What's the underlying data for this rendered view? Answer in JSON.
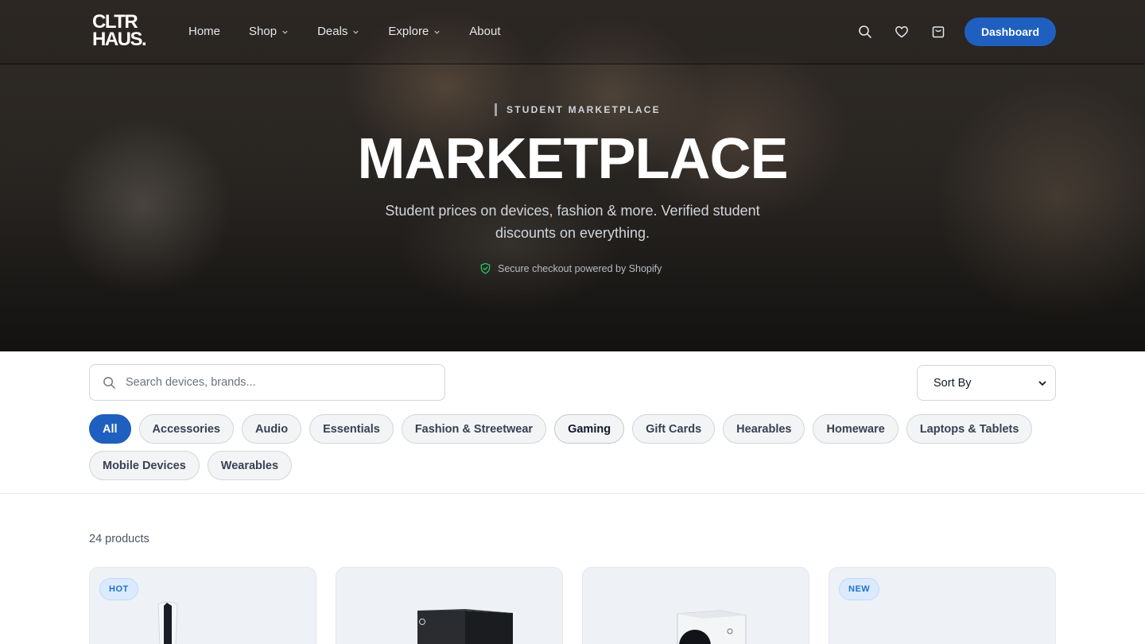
{
  "brand": {
    "logo_line1": "CLTR",
    "logo_line2": "HAUS."
  },
  "nav": {
    "links": [
      {
        "label": "Home",
        "has_dropdown": false
      },
      {
        "label": "Shop",
        "has_dropdown": true
      },
      {
        "label": "Deals",
        "has_dropdown": true
      },
      {
        "label": "Explore",
        "has_dropdown": true
      },
      {
        "label": "About",
        "has_dropdown": false
      }
    ],
    "icons": [
      "search-icon",
      "heart-icon",
      "shopping-bag-icon"
    ],
    "dashboard_label": "Dashboard"
  },
  "hero": {
    "eyebrow": "STUDENT MARKETPLACE",
    "title": "MARKETPLACE",
    "subtitle": "Student prices on devices, fashion & more. Verified student discounts on everything.",
    "secure_text": "Secure checkout powered by Shopify"
  },
  "search": {
    "placeholder": "Search devices, brands...",
    "value": ""
  },
  "sort": {
    "selected": "Sort By"
  },
  "categories": {
    "active": "All",
    "items": [
      "All",
      "Accessories",
      "Audio",
      "Essentials",
      "Fashion & Streetwear",
      "Gaming",
      "Gift Cards",
      "Hearables",
      "Homeware",
      "Laptops & Tablets",
      "Mobile Devices",
      "Wearables"
    ]
  },
  "products": {
    "count_label": "24 products",
    "cards": [
      {
        "badge": "HOT",
        "image_icon": "playstation-console-icon"
      },
      {
        "badge": "",
        "image_icon": "xbox-series-x-icon"
      },
      {
        "badge": "",
        "image_icon": "xbox-series-s-icon"
      },
      {
        "badge": "NEW",
        "image_icon": ""
      }
    ]
  },
  "colors": {
    "accent": "#1f5fbf",
    "badge_bg": "#dbeafe",
    "badge_text": "#1d73c9",
    "secure_icon": "#22c55e"
  }
}
